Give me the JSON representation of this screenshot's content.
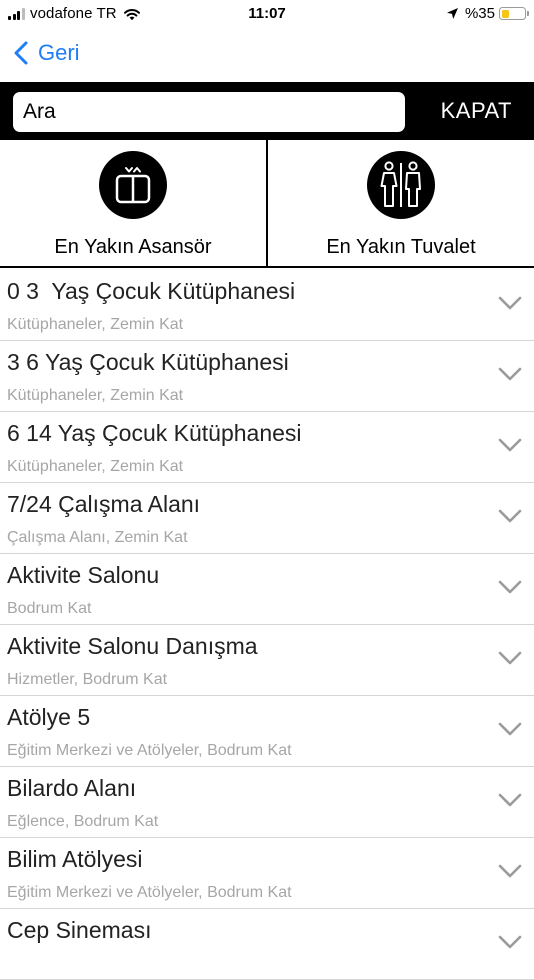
{
  "status_bar": {
    "carrier": "vodafone TR",
    "time": "11:07",
    "battery_percent": "%35",
    "battery_level": 0.35,
    "battery_color": "#f5c518"
  },
  "nav": {
    "back_label": "Geri",
    "accent_color": "#1f7df6"
  },
  "search": {
    "placeholder": "Ara",
    "value": "",
    "close_label": "KAPAT"
  },
  "quick_actions": [
    {
      "label": "En Yakın Asansör",
      "icon": "elevator-icon"
    },
    {
      "label": "En Yakın Tuvalet",
      "icon": "restroom-icon"
    }
  ],
  "list": [
    {
      "title": "0 3  Yaş Çocuk Kütüphanesi",
      "subtitle": "Kütüphaneler, Zemin Kat"
    },
    {
      "title": "3 6 Yaş Çocuk Kütüphanesi",
      "subtitle": "Kütüphaneler, Zemin Kat"
    },
    {
      "title": "6 14 Yaş Çocuk Kütüphanesi",
      "subtitle": "Kütüphaneler, Zemin Kat"
    },
    {
      "title": "7/24 Çalışma Alanı",
      "subtitle": "Çalışma Alanı, Zemin Kat"
    },
    {
      "title": "Aktivite Salonu",
      "subtitle": "Bodrum Kat"
    },
    {
      "title": "Aktivite Salonu Danışma",
      "subtitle": "Hizmetler, Bodrum Kat"
    },
    {
      "title": "Atölye 5",
      "subtitle": "Eğitim Merkezi ve Atölyeler, Bodrum Kat"
    },
    {
      "title": "Bilardo Alanı",
      "subtitle": "Eğlence, Bodrum Kat"
    },
    {
      "title": "Bilim Atölyesi",
      "subtitle": "Eğitim Merkezi ve Atölyeler, Bodrum Kat"
    },
    {
      "title": "Cep Sineması",
      "subtitle": ""
    }
  ]
}
